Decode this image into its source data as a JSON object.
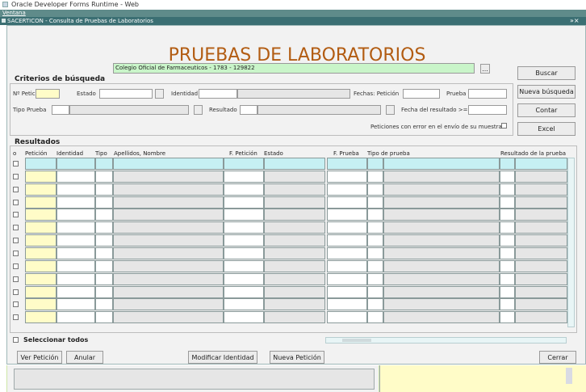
{
  "browser": {
    "title": "Oracle Developer Forms Runtime - Web"
  },
  "menu": {
    "ventana": "Ventana"
  },
  "window": {
    "title": "SACERTICON - Consulta de Pruebas de Laboratorios",
    "controls": "»×"
  },
  "main": {
    "heading": "PRUEBAS DE LABORATORIOS",
    "colegio_value": "Colegio Oficial de Farmaceuticos - 1783 - 129822",
    "ellipsis": "..."
  },
  "actions": {
    "buscar": "Buscar",
    "nueva_busqueda": "Nueva búsqueda",
    "contar": "Contar",
    "excel": "Excel"
  },
  "criteria": {
    "title": "Criterios de búsqueda",
    "n_peticion": "Nº Peticion",
    "estado": "Estado",
    "identidad": "Identidad",
    "fechas_peticion": "Fechas: Petición",
    "prueba": "Prueba",
    "tipo_prueba": "Tipo Prueba",
    "resultado": "Resultado",
    "fecha_resultado": "Fecha del resultado >=",
    "peticiones_error": "Peticiones con error en el envío de su muestra"
  },
  "results": {
    "title": "Resultados",
    "headers": {
      "o": "o",
      "peticion": "Petición",
      "identidad": "Identidad",
      "tipo": "Tipo",
      "apellidos": "Apellidos, Nombre",
      "f_peticion": "F. Petición",
      "estado": "Estado",
      "f_prueba": "F. Prueba",
      "tipo_prueba": "Tipo de prueba",
      "resultado_prueba": "Resultado de la prueba"
    },
    "seleccionar_todos": "Seleccionar todos"
  },
  "footer_buttons": {
    "ver_peticion": "Ver Petición",
    "anular": "Anular",
    "modificar_identidad": "Modificar Identidad",
    "nueva_peticion": "Nueva Petición",
    "cerrar": "Cerrar"
  }
}
